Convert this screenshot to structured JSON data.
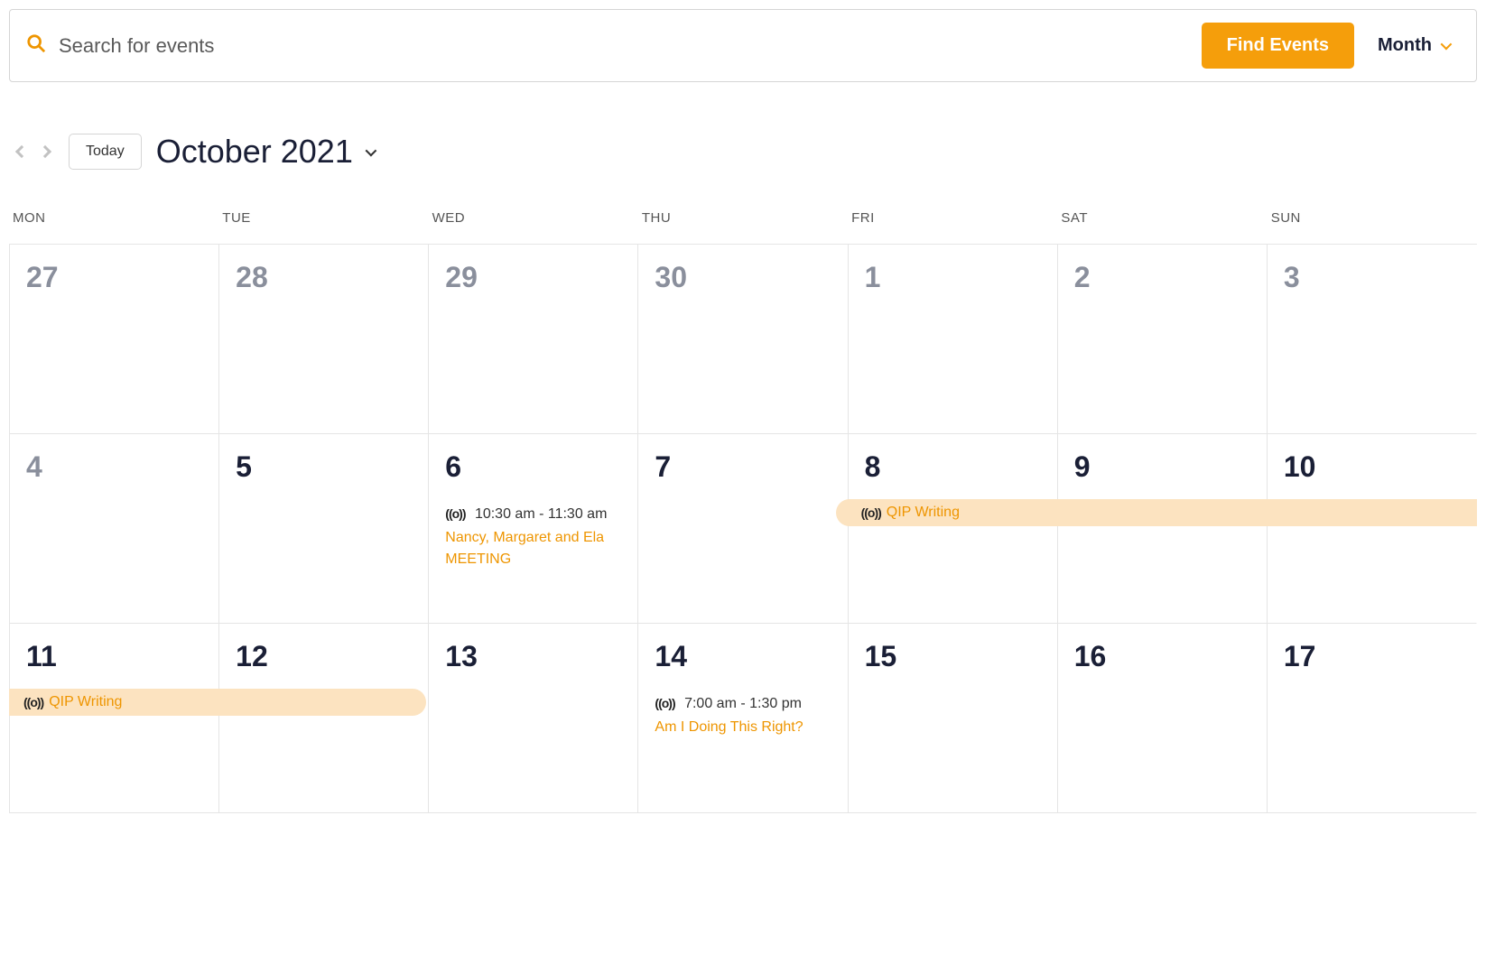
{
  "search": {
    "placeholder": "Search for events",
    "find_button": "Find Events",
    "view_label": "Month"
  },
  "nav": {
    "today_label": "Today",
    "month_title": "October 2021"
  },
  "day_headers": [
    "MON",
    "TUE",
    "WED",
    "THU",
    "FRI",
    "SAT",
    "SUN"
  ],
  "weeks": [
    {
      "days": [
        {
          "num": "27",
          "muted": true
        },
        {
          "num": "28",
          "muted": true
        },
        {
          "num": "29",
          "muted": true
        },
        {
          "num": "30",
          "muted": true
        },
        {
          "num": "1",
          "muted": true
        },
        {
          "num": "2",
          "muted": true
        },
        {
          "num": "3",
          "muted": true
        }
      ]
    },
    {
      "days": [
        {
          "num": "4",
          "muted": true
        },
        {
          "num": "5",
          "muted": false
        },
        {
          "num": "6",
          "muted": false,
          "event": {
            "time": "10:30 am - 11:30 am",
            "title": "Nancy, Margaret and Ela MEETING"
          }
        },
        {
          "num": "7",
          "muted": false
        },
        {
          "num": "8",
          "muted": false,
          "span": {
            "title": "QIP Writing",
            "type": "start"
          }
        },
        {
          "num": "9",
          "muted": false,
          "span": {
            "type": "mid"
          }
        },
        {
          "num": "10",
          "muted": false,
          "span": {
            "type": "end-open"
          }
        }
      ]
    },
    {
      "days": [
        {
          "num": "11",
          "muted": false,
          "span": {
            "title": "QIP Writing",
            "type": "start-continue"
          }
        },
        {
          "num": "12",
          "muted": false,
          "span": {
            "type": "end-round"
          }
        },
        {
          "num": "13",
          "muted": false
        },
        {
          "num": "14",
          "muted": false,
          "event": {
            "time": "7:00 am - 1:30 pm",
            "title": "Am I Doing This Right?"
          }
        },
        {
          "num": "15",
          "muted": false
        },
        {
          "num": "16",
          "muted": false
        },
        {
          "num": "17",
          "muted": false
        }
      ]
    }
  ]
}
